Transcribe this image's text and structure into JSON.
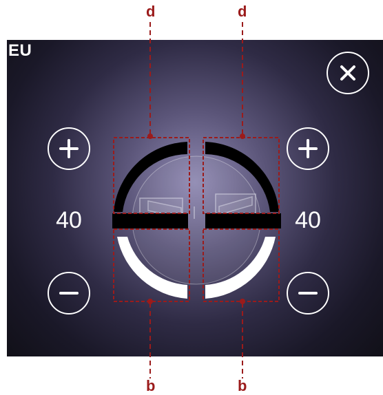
{
  "screen": {
    "region_label": "EU"
  },
  "left_panel": {
    "value": "40",
    "plus_icon": "plus-icon",
    "minus_icon": "minus-icon"
  },
  "right_panel": {
    "value": "40",
    "plus_icon": "plus-icon",
    "minus_icon": "minus-icon"
  },
  "close_icon": "close-icon",
  "callouts": {
    "top_left": "d",
    "top_right": "d",
    "bottom_left": "b",
    "bottom_right": "b"
  },
  "colors": {
    "callout": "#9b1b1b",
    "track_dark": "#000000",
    "track_light": "#ffffff"
  }
}
